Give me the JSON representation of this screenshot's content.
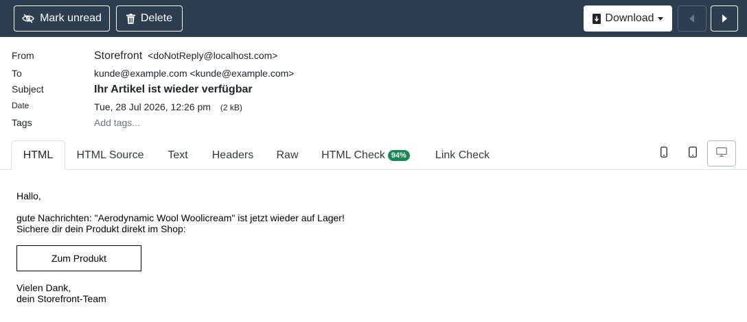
{
  "toolbar": {
    "mark_unread_label": "Mark unread",
    "delete_label": "Delete",
    "download_label": "Download",
    "background_color": "#2d3e50"
  },
  "headers": {
    "from_label": "From",
    "from_name": "Storefront",
    "from_address": "<doNotReply@localhost.com>",
    "to_label": "To",
    "to_value": "kunde@example.com <kunde@example.com>",
    "subject_label": "Subject",
    "subject_value": "Ihr Artikel ist wieder verfügbar",
    "date_label": "Date",
    "date_value": "Tue, 28 Jul 2026, 12:26 pm",
    "size_value": "(2 kB)",
    "tags_label": "Tags",
    "tags_placeholder": "Add tags..."
  },
  "tabs": [
    {
      "label": "HTML",
      "active": true
    },
    {
      "label": "HTML Source"
    },
    {
      "label": "Text"
    },
    {
      "label": "Headers"
    },
    {
      "label": "Raw"
    },
    {
      "label": "HTML Check",
      "badge": "94%",
      "badge_color": "#198754"
    },
    {
      "label": "Link Check"
    }
  ],
  "email": {
    "greeting": "Hallo,",
    "line1": "gute Nachrichten: \"Aerodynamic Wool Woolicream\" ist jetzt wieder auf Lager!",
    "line2": "Sichere dir dein Produkt direkt im Shop:",
    "cta_label": "Zum Produkt",
    "closing1": "Vielen Dank,",
    "closing2": "dein Storefront-Team"
  },
  "icons": {
    "mark_unread": "eye-slash-icon",
    "delete": "trash-icon",
    "download": "file-download-icon",
    "prev": "caret-left-icon",
    "next": "caret-right-icon",
    "device_phone": "phone-icon",
    "device_tablet": "tablet-icon",
    "device_desktop": "monitor-icon"
  }
}
